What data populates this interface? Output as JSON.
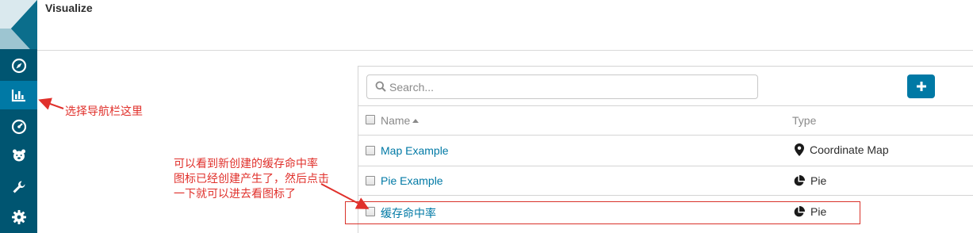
{
  "app": {
    "page_title": "Visualize"
  },
  "sidebar": {
    "items": [
      {
        "name": "discover",
        "icon": "compass-icon",
        "active": false
      },
      {
        "name": "visualize",
        "icon": "bar-chart-icon",
        "active": true
      },
      {
        "name": "dashboard",
        "icon": "dashboard-gauge-icon",
        "active": false
      },
      {
        "name": "timelion",
        "icon": "bear-icon",
        "active": false
      },
      {
        "name": "dev-tools",
        "icon": "wrench-icon",
        "active": false
      },
      {
        "name": "management",
        "icon": "gear-icon",
        "active": false
      }
    ]
  },
  "search": {
    "placeholder": "Search..."
  },
  "add_button": {
    "label": "+"
  },
  "table": {
    "headers": {
      "name": "Name",
      "type": "Type"
    },
    "rows": [
      {
        "title": "Map Example",
        "type": "Coordinate Map",
        "type_icon": "map-marker-icon"
      },
      {
        "title": "Pie Example",
        "type": "Pie",
        "type_icon": "pie-chart-icon"
      },
      {
        "title": "缓存命中率",
        "type": "Pie",
        "type_icon": "pie-chart-icon"
      }
    ]
  },
  "annotations": {
    "nav_note": "选择导航栏这里",
    "list_note_line1": "可以看到新创建的缓存命中率",
    "list_note_line2": "图标已经创建产生了，然后点击",
    "list_note_line3": "一下就可以进去看图标了"
  },
  "colors": {
    "sidebar": "#005571",
    "sidebar_active": "#0079a5",
    "link": "#0079a5",
    "annotation": "#e0302b"
  }
}
